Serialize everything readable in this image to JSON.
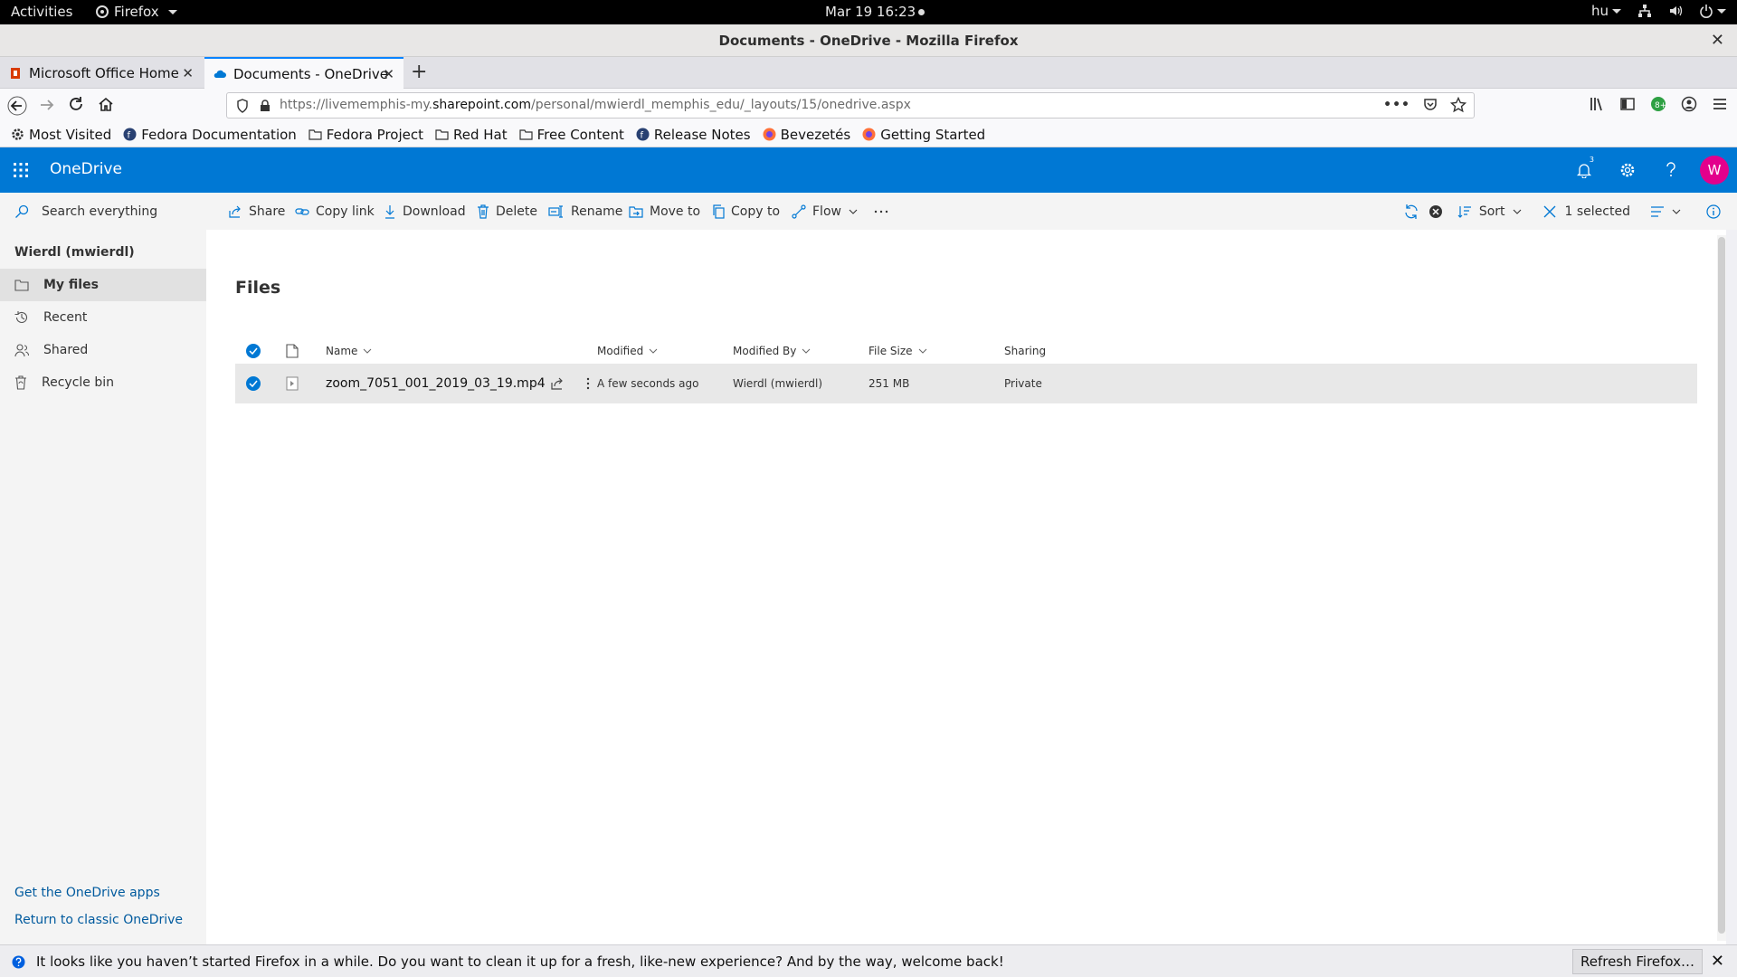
{
  "system": {
    "activities": "Activities",
    "app": "Firefox",
    "clock": "Mar 19  16:23",
    "lang": "hu"
  },
  "window": {
    "title": "Documents - OneDrive - Mozilla Firefox"
  },
  "tabs": [
    {
      "label": "Microsoft Office Home"
    },
    {
      "label": "Documents - OneDrive"
    }
  ],
  "urlbar": {
    "prefix": "https://livememphis-my.",
    "domain": "sharepoint.com",
    "path": "/personal/mwierdl_memphis_edu/_layouts/15/onedrive.aspx"
  },
  "bookmarks": [
    {
      "label": "Most Visited",
      "icon": "gear-icon"
    },
    {
      "label": "Fedora Documentation",
      "icon": "fedora-icon"
    },
    {
      "label": "Fedora Project",
      "icon": "folder-icon"
    },
    {
      "label": "Red Hat",
      "icon": "folder-icon"
    },
    {
      "label": "Free Content",
      "icon": "folder-icon"
    },
    {
      "label": "Release Notes",
      "icon": "fedora-icon"
    },
    {
      "label": "Bevezetés",
      "icon": "firefox-icon"
    },
    {
      "label": "Getting Started",
      "icon": "firefox-icon"
    }
  ],
  "onedrive": {
    "brand": "OneDrive",
    "notification_count": "3",
    "avatar_initial": "W",
    "brand_color": "#0078d4"
  },
  "commandbar": {
    "search_placeholder": "Search everything",
    "commands": [
      {
        "label": "Share",
        "icon": "share-icon"
      },
      {
        "label": "Copy link",
        "icon": "link-icon"
      },
      {
        "label": "Download",
        "icon": "download-icon"
      },
      {
        "label": "Delete",
        "icon": "delete-icon"
      },
      {
        "label": "Rename",
        "icon": "rename-icon"
      },
      {
        "label": "Move to",
        "icon": "move-icon"
      },
      {
        "label": "Copy to",
        "icon": "copy-icon"
      },
      {
        "label": "Flow",
        "icon": "flow-icon"
      }
    ],
    "sort_label": "Sort",
    "selected_label": "1 selected"
  },
  "sidebar": {
    "user": "Wierdl (mwierdl)",
    "items": [
      {
        "label": "My files",
        "icon": "folder-icon"
      },
      {
        "label": "Recent",
        "icon": "history-icon"
      },
      {
        "label": "Shared",
        "icon": "people-icon"
      },
      {
        "label": "Recycle bin",
        "icon": "recycle-icon"
      }
    ],
    "footer_links": [
      "Get the OneDrive apps",
      "Return to classic OneDrive"
    ]
  },
  "main": {
    "title": "Files",
    "columns": [
      "Name",
      "Modified",
      "Modified By",
      "File Size",
      "Sharing"
    ],
    "rows": [
      {
        "name": "zoom_7051_001_2019_03_19.mp4",
        "modified": "A few seconds ago",
        "modified_by": "Wierdl (mwierdl)",
        "size": "251 MB",
        "sharing": "Private"
      }
    ]
  },
  "notification": {
    "message": "It looks like you haven’t started Firefox in a while. Do you want to clean it up for a fresh, like-new experience? And by the way, welcome back!",
    "button": "Refresh Firefox…"
  }
}
